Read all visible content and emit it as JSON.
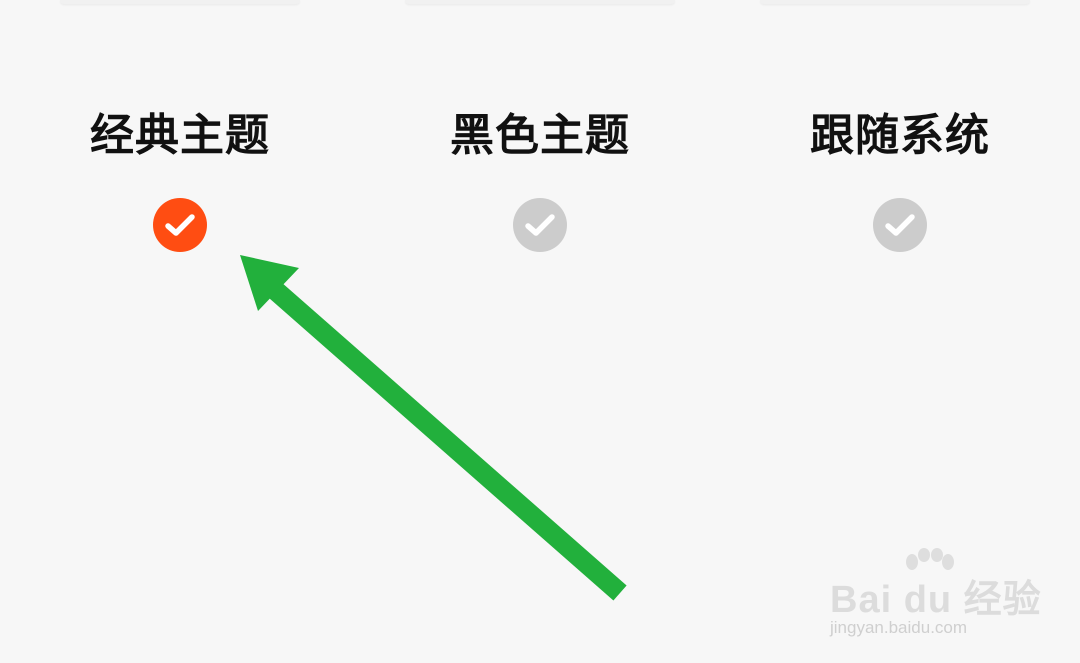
{
  "theme_selector": {
    "options": [
      {
        "label": "经典主题",
        "selected": true
      },
      {
        "label": "黑色主题",
        "selected": false
      },
      {
        "label": "跟随系统",
        "selected": false
      }
    ]
  },
  "colors": {
    "selected_check": "#ff4d12",
    "unselected_check": "#cccccc",
    "check_mark": "#ffffff",
    "annotation_arrow": "#22b03c",
    "background": "#f7f7f7",
    "label_text": "#111111"
  },
  "icons": {
    "check": "check-circle-icon",
    "annotation": "arrow-icon"
  },
  "watermark": {
    "brand": "Bai du 经验",
    "url": "jingyan.baidu.com"
  }
}
